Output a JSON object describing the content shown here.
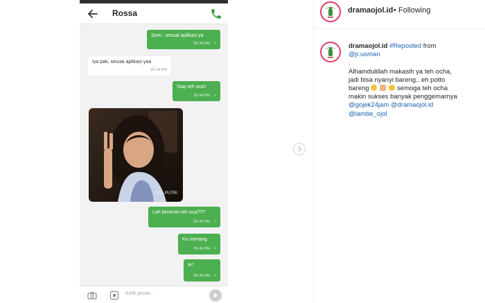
{
  "chat": {
    "contact_name": "Rossa",
    "messages": [
      {
        "dir": "out",
        "text": "Sore.. sesuai aplikasi ya",
        "time": "05.44 PM"
      },
      {
        "dir": "in",
        "text": "Iya pak, sesuai aplikasi yaa",
        "time": "05.44 PM"
      },
      {
        "dir": "out",
        "text": "Siap teh oca!!",
        "time": "05.44 PM"
      },
      {
        "dir": "out",
        "text": "Loh beneran teh oca???",
        "time": "05.46 PM"
      },
      {
        "dir": "out",
        "text": "Ku menang",
        "time": "05.46 PM"
      },
      {
        "dir": "out",
        "text": "Ie*",
        "time": "05.46 PM"
      }
    ],
    "photo_tag": "OCA.PUTRI",
    "input_placeholder": "Ketik pesan..",
    "accent": "#4caf50"
  },
  "post": {
    "username": "dramaojol.id",
    "separator": "•",
    "follow_status": "Following",
    "caption": {
      "username": "dramaojol.id",
      "hashtag": "#Reposted",
      "from_text": "from",
      "source_mention": "@jr.usman",
      "dot_line": ".",
      "body_line1": "Alhamdulillah makasih ya teh ocha,",
      "body_line2": "jadi bisa nyanyi bareng.. eh potto",
      "body_line3_start": "bareng",
      "body_line3_end": "semoga teh ocha",
      "body_line4": "makin sukses banyak penggemarnya",
      "mention1": "@gojek24jam",
      "mention2": "@dramaojol.id",
      "mention3": "@lambe_ojol"
    },
    "link_color": "#1a5fb4",
    "ring_color": "#e03a6f"
  },
  "icons": [
    "back-arrow-icon",
    "phone-icon",
    "camera-icon",
    "sticker-icon",
    "send-icon",
    "chevron-right-icon",
    "sunglasses-emoji",
    "praying-hands-emoji",
    "heart-eyes-emoji"
  ]
}
